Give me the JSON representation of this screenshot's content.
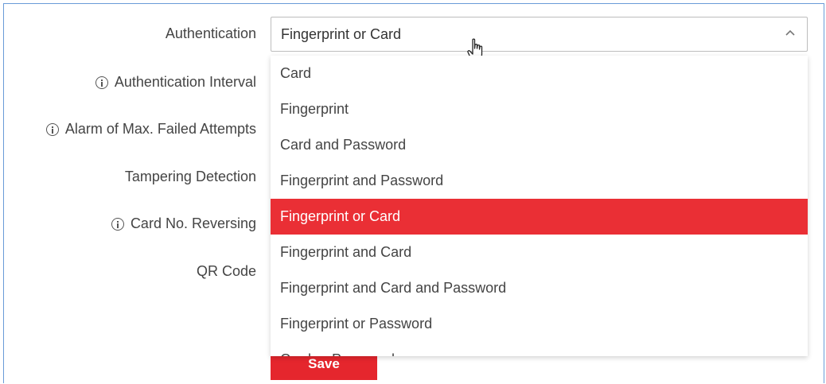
{
  "form": {
    "labels": [
      {
        "text": "Authentication",
        "info": false
      },
      {
        "text": "Authentication Interval",
        "info": true
      },
      {
        "text": "Alarm of Max. Failed Attempts",
        "info": true
      },
      {
        "text": "Tampering Detection",
        "info": false
      },
      {
        "text": "Card No. Reversing",
        "info": true
      },
      {
        "text": "QR Code",
        "info": false
      }
    ],
    "authentication_value": "Fingerprint or Card",
    "save_label": "Save"
  },
  "dropdown": {
    "options": [
      "Card",
      "Fingerprint",
      "Card and Password",
      "Fingerprint and Password",
      "Fingerprint or Card",
      "Fingerprint and Card",
      "Fingerprint and Card and Password",
      "Fingerprint or Password",
      "Card or Password"
    ],
    "selected_index": 4
  },
  "colors": {
    "accent": "#e5262d",
    "frame": "#6a9bd8"
  },
  "icons": {
    "info": "info-circle-icon",
    "chevron": "chevron-up-icon",
    "cursor": "hand-pointer-icon"
  }
}
